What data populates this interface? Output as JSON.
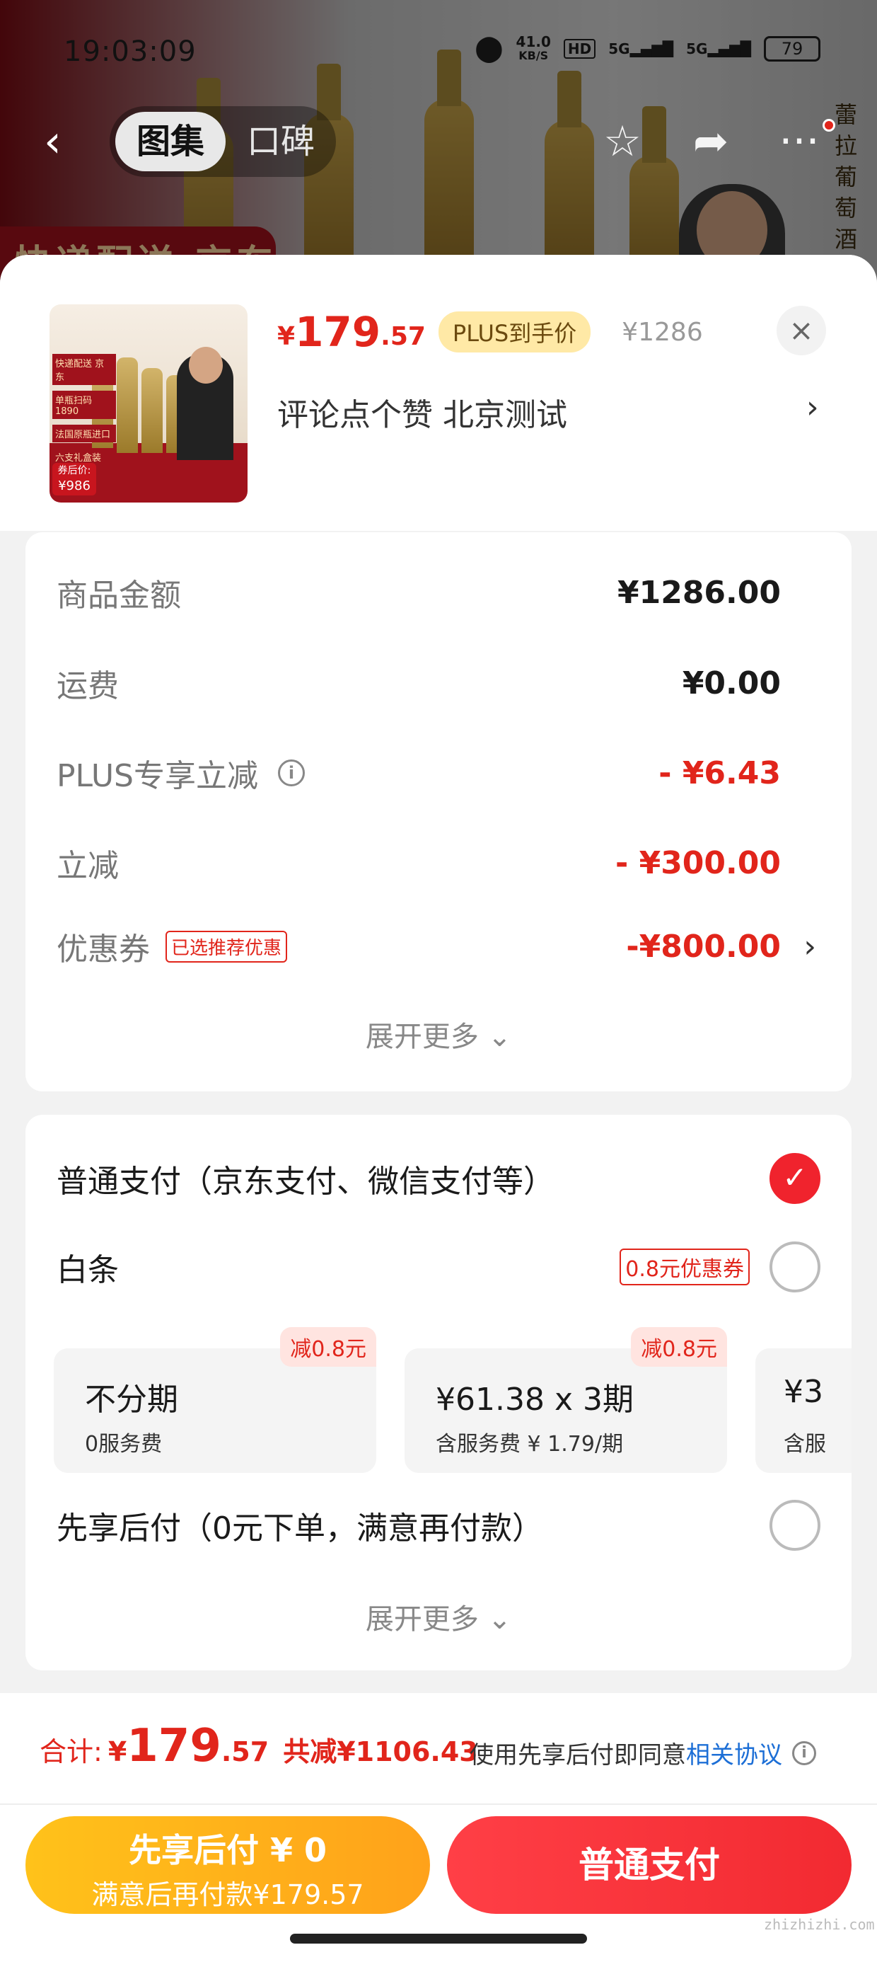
{
  "status_bar": {
    "time": "19:03:09",
    "speed_value": "41.0",
    "speed_unit": "KB/S",
    "hd": "HD",
    "net1": "5G",
    "net2": "5G",
    "battery": "79"
  },
  "nav": {
    "tabs": [
      "图集",
      "口碑"
    ],
    "active_tab": "图集"
  },
  "background": {
    "banner_text": "快递配送 京东",
    "side_text": "蕾拉葡萄酒"
  },
  "product": {
    "price_symbol": "¥",
    "price_int": "179",
    "price_dec": ".57",
    "plus_badge": "PLUS到手价",
    "original_price": "¥1286",
    "name": "评论点个赞  北京测试",
    "thumb_tags": [
      "快递配送 京东",
      "单瓶扫码1890",
      "法国原瓶进口",
      "六支礼盒装"
    ],
    "thumb_label_1": "券后价:",
    "thumb_label_2": "¥986"
  },
  "breakdown": {
    "rows": [
      {
        "label": "商品金额",
        "value": "¥1286.00"
      },
      {
        "label": "运费",
        "value": "¥0.00"
      },
      {
        "label": "PLUS专享立减",
        "value": "- ¥6.43"
      },
      {
        "label": "立减",
        "value": "- ¥300.00"
      },
      {
        "label": "优惠券",
        "value": "-¥800.00",
        "tag": "已选推荐优惠"
      }
    ],
    "expand_label": "展开更多"
  },
  "payment": {
    "normal_label": "普通支付（京东支付、微信支付等）",
    "baitiao_label": "白条",
    "baitiao_coupon": "0.8元优惠券",
    "plans": [
      {
        "title": "不分期",
        "sub": "0服务费",
        "badge": "减0.8元"
      },
      {
        "title": "¥61.38 x 3期",
        "sub": "含服务费 ¥ 1.79/期",
        "badge": "减0.8元"
      },
      {
        "title": "¥3",
        "sub": "含服"
      }
    ],
    "later_label": "先享后付（0元下单，满意再付款）",
    "expand_label": "展开更多"
  },
  "bottom": {
    "total_label": "合计:",
    "total_sym": "¥",
    "total_int": "179",
    "total_dec": ".57",
    "saved": "共减¥1106.43",
    "agree_prefix": "使用先享后付即同意",
    "agree_link": "相关协议",
    "btn_later_line1": "先享后付 ¥ 0",
    "btn_later_line2": "满意后再付款¥179.57",
    "btn_pay": "普通支付",
    "watermark": "zhizhizhi.com"
  },
  "colors": {
    "accent_red": "#e1251b",
    "plus_yellow": "#ffe9a6",
    "pay_later_yellow": "#ffb81a",
    "link_blue": "#1d6fd6"
  }
}
